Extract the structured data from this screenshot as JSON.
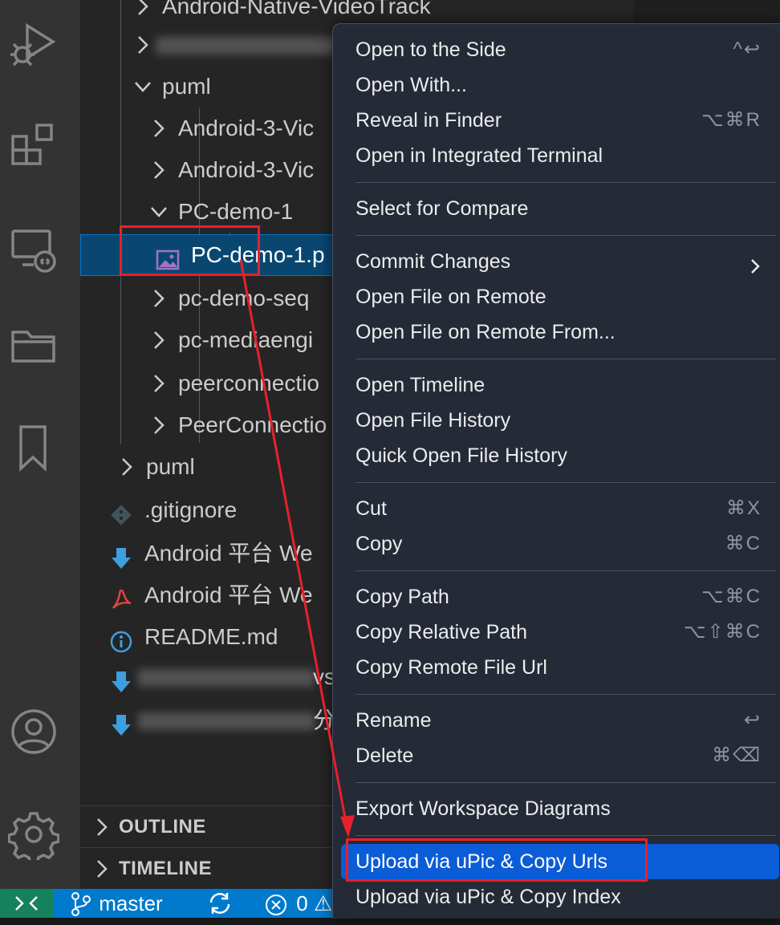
{
  "explorer": {
    "rows": [
      {
        "label": "Android-Native-VideoTrack",
        "expanded": false
      },
      {
        "label": "oTr",
        "expanded": false,
        "blurred": true
      },
      {
        "label": "puml",
        "expanded": true
      },
      {
        "label": "Android-3-Vic",
        "expanded": false
      },
      {
        "label": "Android-3-Vic",
        "expanded": false
      },
      {
        "label": "PC-demo-1",
        "expanded": true
      },
      {
        "label": "PC-demo-1.p",
        "selected": true,
        "icon": "image-file-icon"
      },
      {
        "label": "pc-demo-seq",
        "expanded": false
      },
      {
        "label": "pc-mediaengi",
        "expanded": false
      },
      {
        "label": "peerconnectio",
        "expanded": false
      },
      {
        "label": "PeerConnectio",
        "expanded": false
      },
      {
        "label": "puml",
        "expanded": false
      },
      {
        "label": ".gitignore",
        "icon": "git-file-icon"
      },
      {
        "label": "Android 平台 We",
        "icon": "download-file-icon"
      },
      {
        "label": "Android 平台 We",
        "icon": "pdf-file-icon"
      },
      {
        "label": "README.md",
        "icon": "info-file-icon"
      },
      {
        "label": "vs Pl",
        "icon": "download-file-icon",
        "blurred": true
      },
      {
        "label": "分",
        "icon": "download-file-icon",
        "blurred": true
      }
    ],
    "sections": {
      "outline": "OUTLINE",
      "timeline": "TIMELINE"
    }
  },
  "statusbar": {
    "branch": "master",
    "errors": "0",
    "partial": "⚠"
  },
  "context_menu": {
    "groups": [
      [
        {
          "label": "Open to the Side",
          "shortcut": "^↩"
        },
        {
          "label": "Open With...",
          "shortcut": ""
        },
        {
          "label": "Reveal in Finder",
          "shortcut": "⌥⌘R"
        },
        {
          "label": "Open in Integrated Terminal",
          "shortcut": ""
        }
      ],
      [
        {
          "label": "Select for Compare",
          "shortcut": ""
        }
      ],
      [
        {
          "label": "Commit Changes",
          "shortcut": "",
          "submenu": true
        },
        {
          "label": "Open File on Remote",
          "shortcut": ""
        },
        {
          "label": "Open File on Remote From...",
          "shortcut": ""
        }
      ],
      [
        {
          "label": "Open Timeline",
          "shortcut": ""
        },
        {
          "label": "Open File History",
          "shortcut": ""
        },
        {
          "label": "Quick Open File History",
          "shortcut": ""
        }
      ],
      [
        {
          "label": "Cut",
          "shortcut": "⌘X"
        },
        {
          "label": "Copy",
          "shortcut": "⌘C"
        }
      ],
      [
        {
          "label": "Copy Path",
          "shortcut": "⌥⌘C"
        },
        {
          "label": "Copy Relative Path",
          "shortcut": "⌥⇧⌘C"
        },
        {
          "label": "Copy Remote File Url",
          "shortcut": ""
        }
      ],
      [
        {
          "label": "Rename",
          "shortcut": "↩"
        },
        {
          "label": "Delete",
          "shortcut": "⌘⌫"
        }
      ],
      [
        {
          "label": "Export Workspace Diagrams",
          "shortcut": ""
        }
      ],
      [
        {
          "label": "Upload via uPic & Copy Urls",
          "shortcut": "",
          "highlighted": true
        },
        {
          "label": "Upload via uPic & Copy Index",
          "shortcut": ""
        }
      ]
    ]
  },
  "colors": {
    "selection": "#094771",
    "menu_highlight": "#0b5cd7",
    "annotation": "#e8202a",
    "statusbar": "#007acc"
  }
}
